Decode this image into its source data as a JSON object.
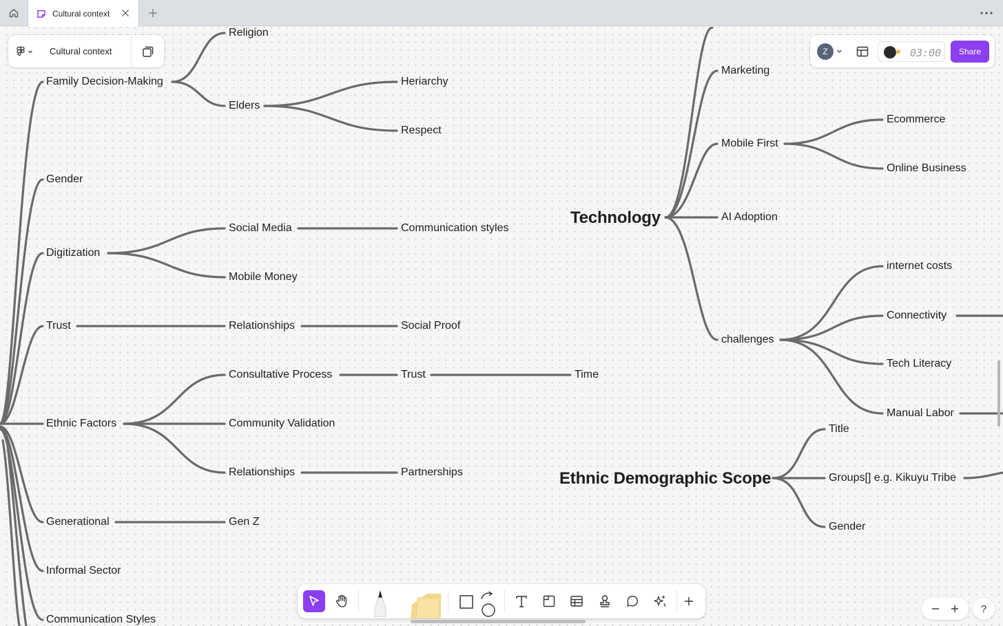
{
  "tabs": {
    "home_icon": "home-icon",
    "active": {
      "label": "Cultural context",
      "icon": "whiteboard-file-icon"
    },
    "new_tab_icon": "plus-icon",
    "more_icon": "more-horizontal-icon"
  },
  "file_panel": {
    "menu_icon": "figma-logo-icon",
    "file_name": "Cultural context",
    "pages_icon": "pages-icon"
  },
  "header_right": {
    "avatar_initial": "Z",
    "layout_icon": "layout-icon",
    "timer": "03:00",
    "share_label": "Share"
  },
  "mindmap": {
    "left_branches": [
      {
        "label": "Family Decision-Making",
        "children": [
          {
            "label": "Religion"
          },
          {
            "label": "Elders",
            "children": [
              {
                "label": "Heriarchy"
              },
              {
                "label": "Respect"
              }
            ]
          }
        ]
      },
      {
        "label": "Gender"
      },
      {
        "label": "Digitization",
        "children": [
          {
            "label": "Social Media",
            "children": [
              {
                "label": "Communication styles"
              }
            ]
          },
          {
            "label": "Mobile Money"
          }
        ]
      },
      {
        "label": "Trust",
        "children": [
          {
            "label": "Relationships",
            "children": [
              {
                "label": "Social Proof"
              }
            ]
          }
        ]
      },
      {
        "label": "Ethnic Factors",
        "children": [
          {
            "label": "Consultative Process",
            "children": [
              {
                "label": "Trust",
                "children": [
                  {
                    "label": "Time"
                  }
                ]
              }
            ]
          },
          {
            "label": "Community Validation"
          },
          {
            "label": "Relationships",
            "children": [
              {
                "label": "Partnerships"
              }
            ]
          }
        ]
      },
      {
        "label": "Generational",
        "children": [
          {
            "label": "Gen Z"
          }
        ]
      },
      {
        "label": "Informal Sector"
      },
      {
        "label": "Communication Styles"
      }
    ],
    "technology": {
      "label": "Technology",
      "children": [
        {
          "label": "Marketing"
        },
        {
          "label": "Mobile First",
          "children": [
            {
              "label": "Ecommerce"
            },
            {
              "label": "Online Business"
            }
          ]
        },
        {
          "label": "AI Adoption"
        },
        {
          "label": "challenges",
          "children": [
            {
              "label": "internet costs"
            },
            {
              "label": "Connectivity"
            },
            {
              "label": "Tech Literacy"
            },
            {
              "label": "Manual Labor"
            }
          ]
        }
      ]
    },
    "ethnic_scope": {
      "label": "Ethnic Demographic Scope",
      "children": [
        {
          "label": "Title"
        },
        {
          "label": "Groups[] e.g. Kikuyu Tribe"
        },
        {
          "label": "Gender"
        }
      ]
    }
  },
  "toolbar": {
    "tools": [
      "move-tool-icon",
      "hand-tool-icon",
      "marker-tool-icon",
      "sticky-note-icon",
      "shape-tool-icon",
      "connector-icon",
      "text-tool-icon",
      "section-tool-icon",
      "table-tool-icon",
      "stamp-tool-icon",
      "comment-tool-icon",
      "ai-tool-icon",
      "more-tools-icon"
    ],
    "active_tool": "move-tool-icon"
  },
  "zoom": {
    "out_icon": "minus-icon",
    "in_icon": "plus-icon"
  },
  "help_label": "?",
  "colors": {
    "accent": "#8b3ff0",
    "connector": "#6a6a6a",
    "canvas": "#f6f6f6"
  }
}
